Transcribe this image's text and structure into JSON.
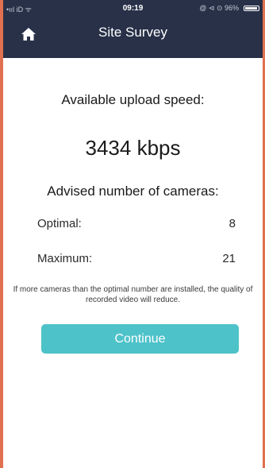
{
  "status_bar": {
    "left": "•ııl iD ᯤ",
    "time": "09:19",
    "right": "@ ⊲ ⊙ 96%",
    "battery_icon": "battery-icon"
  },
  "header": {
    "title": "Site Survey",
    "home_icon": "home-icon",
    "background": "#283148"
  },
  "main": {
    "upload_label": "Available upload speed:",
    "speed": "3434 kbps",
    "advised_label": "Advised number of cameras:",
    "optimal_label": "Optimal:",
    "optimal_value": "8",
    "maximum_label": "Maximum:",
    "maximum_value": "21",
    "note": "If more cameras than the optimal number are installed, the quality of recorded video will reduce.",
    "continue_label": "Continue",
    "button_color": "#4dc2c9",
    "frame_color": "#e0704f"
  }
}
